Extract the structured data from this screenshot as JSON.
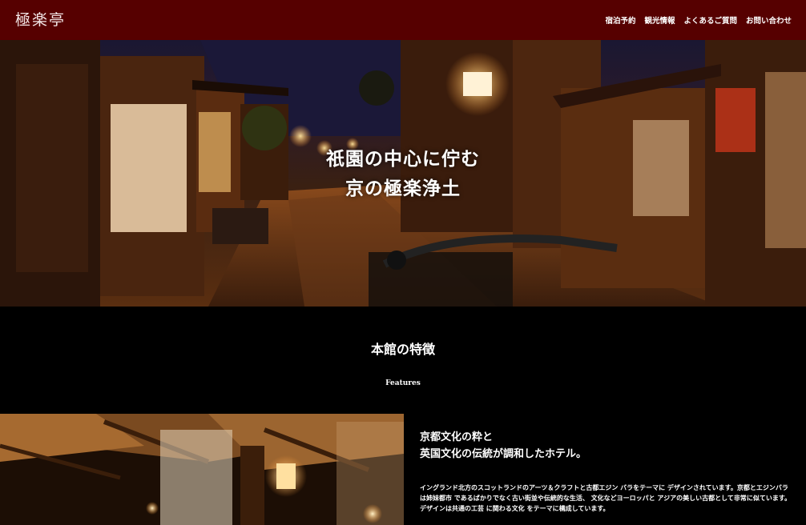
{
  "header": {
    "logo": "極楽亭",
    "nav": [
      "宿泊予約",
      "観光情報",
      "よくあるご質問",
      "お問い合わせ"
    ]
  },
  "hero": {
    "line1": "祇園の中心に佇む",
    "line2": "京の極楽浄土"
  },
  "features": {
    "title": "本館の特徴",
    "subtitle": "Features",
    "heading_line1": "京都文化の粋と",
    "heading_line2": "英国文化の伝統が調和したホテル。",
    "body": "イングランド北方のスコットランドのアーツ＆クラフトと古都エジン バラをテーマに デザインされています。京都とエジンバラは姉妹都市 であるばかりでなく古い街並や伝統的な生活、 文化などヨーロッパと アジアの美しい古都として非常に似ています。デザインは共通の工芸 に関わる文化 をテーマに構成しています。"
  },
  "colors": {
    "header_bg": "#560000",
    "page_bg": "#000000"
  }
}
